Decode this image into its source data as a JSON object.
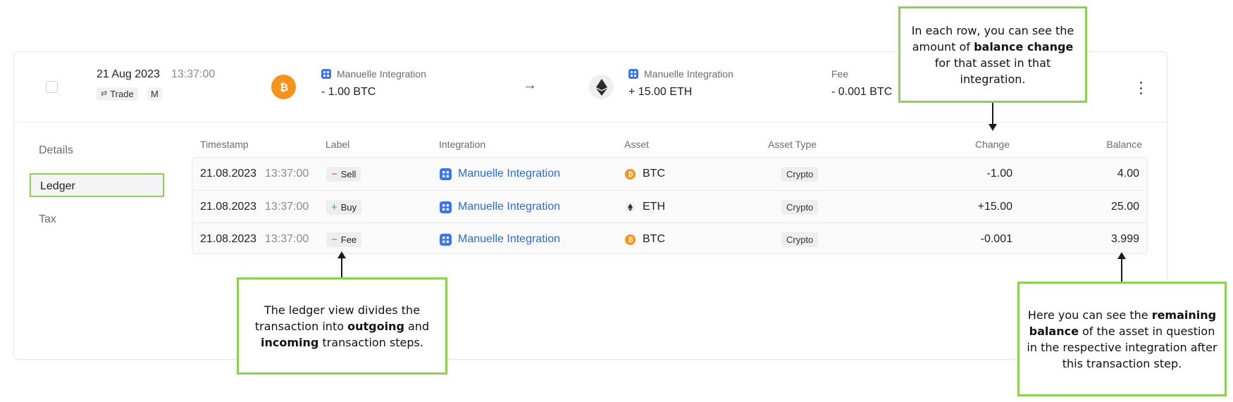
{
  "transaction": {
    "date": "21 Aug 2023",
    "time": "13:37:00",
    "type_label": "Trade",
    "mode_badge": "M",
    "outgoing": {
      "integration": "Manuelle Integration",
      "amount": "- 1.00 BTC",
      "asset_icon": "bitcoin-icon"
    },
    "arrow": "→",
    "incoming": {
      "integration": "Manuelle Integration",
      "amount": "+ 15.00 ETH",
      "asset_icon": "ethereum-icon"
    },
    "fee": {
      "label": "Fee",
      "value": "- 0.001 BTC"
    }
  },
  "sidebar": {
    "items": [
      {
        "label": "Details",
        "active": false
      },
      {
        "label": "Ledger",
        "active": true
      },
      {
        "label": "Tax",
        "active": false
      }
    ]
  },
  "ledger": {
    "columns": {
      "timestamp": "Timestamp",
      "label": "Label",
      "integration": "Integration",
      "asset": "Asset",
      "asset_type": "Asset Type",
      "change": "Change",
      "balance": "Balance"
    },
    "rows": [
      {
        "date": "21.08.2023",
        "time": "13:37:00",
        "sign": "−",
        "label": "Sell",
        "integration": "Manuelle Integration",
        "asset": "BTC",
        "asset_type": "Crypto",
        "change": "-1.00",
        "balance": "4.00"
      },
      {
        "date": "21.08.2023",
        "time": "13:37:00",
        "sign": "+",
        "label": "Buy",
        "integration": "Manuelle Integration",
        "asset": "ETH",
        "asset_type": "Crypto",
        "change": "+15.00",
        "balance": "25.00"
      },
      {
        "date": "21.08.2023",
        "time": "13:37:00",
        "sign": "−",
        "label": "Fee",
        "integration": "Manuelle Integration",
        "asset": "BTC",
        "asset_type": "Crypto",
        "change": "-0.001",
        "balance": "3.999"
      }
    ]
  },
  "callouts": {
    "top": {
      "pre": "In each row, you can see the amount of ",
      "bold": "balance change",
      "post": " for that asset in that integration."
    },
    "middle": {
      "pre": "The ledger view divides the transaction into ",
      "bold1": "outgoing",
      "mid": " and ",
      "bold2": "incoming",
      "post": " transaction steps."
    },
    "right": {
      "pre": "Here you can see the ",
      "bold": "remaining balance",
      "post": " of the asset in question in the respective integration after this transaction step."
    }
  },
  "colors": {
    "accent_green": "#8dd154",
    "link_blue": "#2a6bd8",
    "integration_icon": "#3a76f0",
    "btc_orange": "#f7931a",
    "minus_red": "#e04a4a",
    "plus_green": "#3aa55d"
  }
}
